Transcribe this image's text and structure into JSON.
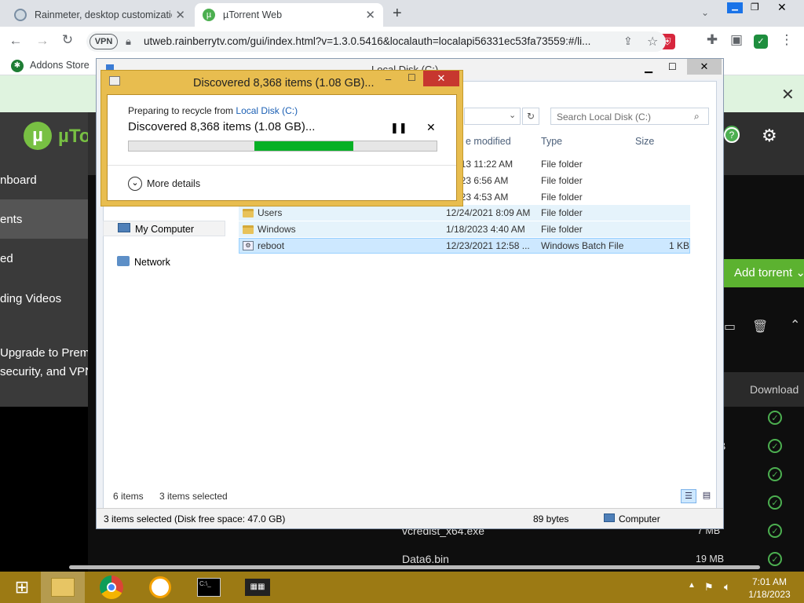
{
  "browser": {
    "tabs": [
      {
        "title": "Rainmeter, desktop customizatio",
        "favicon": "rainmeter-icon"
      },
      {
        "title": "µTorrent Web",
        "favicon": "utorrent-icon"
      }
    ],
    "new_tab_label": "+",
    "url": "utweb.rainberrytv.com/gui/index.html?v=1.3.0.5416&localauth=localapi56331ec53fa73559:#/li...",
    "vpn_label": "VPN",
    "bookmarks": [
      {
        "label": "Addons Store"
      }
    ]
  },
  "utorrent": {
    "logo_text": "µTorr",
    "sidebar": [
      {
        "label": "nboard"
      },
      {
        "label": "ents"
      },
      {
        "label": "ed"
      },
      {
        "label": "ding Videos"
      }
    ],
    "upgrade_line1": "Upgrade to Premi",
    "upgrade_line2": "security, and VPN",
    "add_torrent": "Add torrent",
    "download_col": "Download",
    "rows": [
      {
        "name": "",
        "size": ""
      },
      {
        "name": "",
        "size": "B"
      },
      {
        "name": "",
        "size": ""
      },
      {
        "name": "",
        "size": ""
      },
      {
        "name": "vcredist_x64.exe",
        "size": "7 MB"
      },
      {
        "name": "Data6.bin",
        "size": "19 MB"
      }
    ]
  },
  "explorer": {
    "title": "Local Disk (C:)",
    "search_placeholder": "Search Local Disk (C:)",
    "columns": {
      "modified": "e modified",
      "type": "Type",
      "size": "Size"
    },
    "files": [
      {
        "name": "",
        "modified": "/2013 11:22 AM",
        "type": "File folder",
        "size": ""
      },
      {
        "name": "",
        "modified": "/2023 6:56 AM",
        "type": "File folder",
        "size": ""
      },
      {
        "name": "",
        "modified": "/2023 4:53 AM",
        "type": "File folder",
        "size": ""
      },
      {
        "name": "Users",
        "modified": "12/24/2021 8:09 AM",
        "type": "File folder",
        "size": ""
      },
      {
        "name": "Windows",
        "modified": "1/18/2023 4:40 AM",
        "type": "File folder",
        "size": ""
      },
      {
        "name": "reboot",
        "modified": "12/23/2021 12:58 ...",
        "type": "Windows Batch File",
        "size": "1 KB"
      }
    ],
    "nav": [
      {
        "label": "My Computer"
      },
      {
        "label": "Network"
      }
    ],
    "item_count": "6 items",
    "selected_count": "3 items selected",
    "status_left": "3 items selected (Disk free space: 47.0 GB)",
    "status_size": "89 bytes",
    "status_location": "Computer"
  },
  "dialog": {
    "title": "Discovered 8,368 items (1.08 GB)...",
    "preparing": "Preparing to recycle from",
    "source_link": "Local Disk (C:)",
    "heading": "Discovered 8,368 items (1.08 GB)...",
    "more_details": "More details",
    "progress_fraction": 0.32
  },
  "taskbar": {
    "time": "7:01 AM",
    "date": "1/18/2023"
  }
}
